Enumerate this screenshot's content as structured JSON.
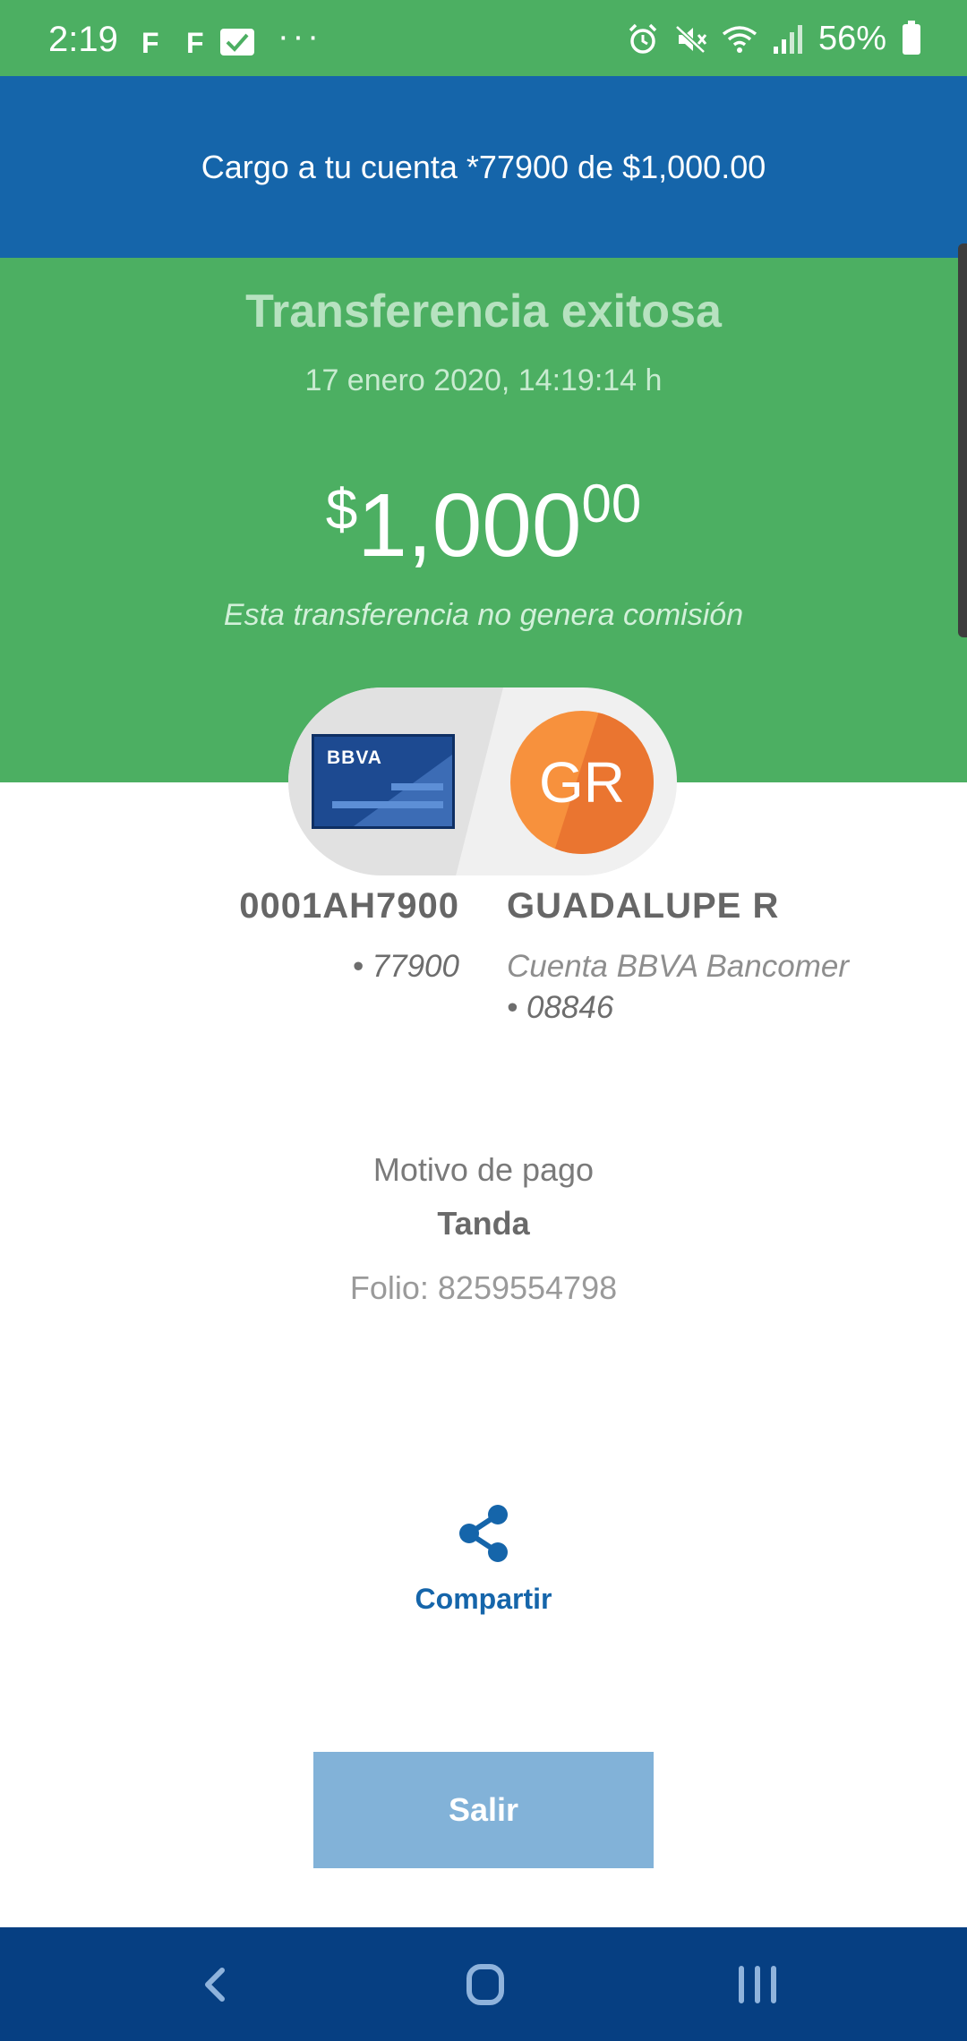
{
  "status_bar": {
    "time": "2:19",
    "app_icon_1": "F",
    "app_icon_2": "F",
    "more": "···",
    "battery": "56%"
  },
  "header": {
    "charge_text": "Cargo a tu cuenta *77900 de $1,000.00"
  },
  "transfer": {
    "title": "Transferencia exitosa",
    "datetime": "17 enero 2020, 14:19:14 h",
    "amount_sign": "$",
    "amount_main": "1,000",
    "amount_cents": "00",
    "note": "Esta transferencia no genera comisión"
  },
  "sender": {
    "card_logo": "BBVA",
    "name": "0001AH7900",
    "account": "• 77900"
  },
  "recipient": {
    "initials": "GR",
    "name": "GUADALUPE R",
    "bank": "Cuenta BBVA Bancomer",
    "account": "• 08846"
  },
  "details": {
    "motivo_label": "Motivo de pago",
    "motivo_value": "Tanda",
    "folio": "Folio: 8259554798"
  },
  "actions": {
    "share_label": "Compartir",
    "exit_label": "Salir"
  },
  "colors": {
    "status_green": "#4caf62",
    "header_blue": "#1565aa",
    "avatar_orange": "#f7913d",
    "button_blue": "#82b2d8",
    "nav_blue": "#063f82"
  },
  "icons": {
    "share": "share-icon",
    "back": "back-icon",
    "home": "home-icon",
    "recent": "recent-apps-icon"
  }
}
